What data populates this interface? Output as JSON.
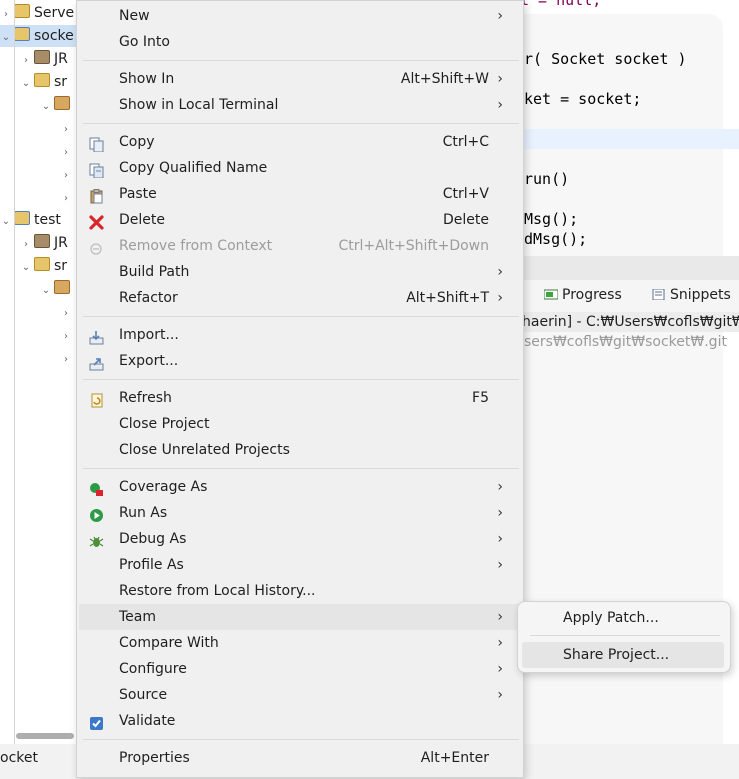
{
  "explorer": {
    "rows": [
      {
        "label": "Serve",
        "arrow": "›",
        "icon": "folder-icon"
      },
      {
        "label": "socke",
        "arrow": "⌄",
        "icon": "project-icon",
        "selected": true
      },
      {
        "label": "JR",
        "arrow": "›",
        "icon": "library-icon"
      },
      {
        "label": "sr",
        "arrow": "⌄",
        "icon": "source-folder-icon"
      },
      {
        "label": "",
        "arrow": "⌄",
        "icon": "package-icon"
      },
      {
        "label": "",
        "arrow": "›",
        "icon": ""
      },
      {
        "label": "",
        "arrow": "›",
        "icon": ""
      },
      {
        "label": "",
        "arrow": "›",
        "icon": ""
      },
      {
        "label": "",
        "arrow": "›",
        "icon": ""
      },
      {
        "label": "test",
        "arrow": "⌄",
        "icon": "project-icon"
      },
      {
        "label": "JR",
        "arrow": "›",
        "icon": "library-icon"
      },
      {
        "label": "sr",
        "arrow": "⌄",
        "icon": "source-folder-icon"
      },
      {
        "label": "",
        "arrow": "⌄",
        "icon": "package-icon"
      },
      {
        "label": "",
        "arrow": "›",
        "icon": ""
      },
      {
        "label": "",
        "arrow": "›",
        "icon": ""
      },
      {
        "label": "",
        "arrow": "›",
        "icon": ""
      }
    ]
  },
  "status": {
    "text": "ocket"
  },
  "editor": {
    "top_fragment": "t          = null;",
    "lines": [
      "r( Socket socket )",
      "ket = socket;",
      "",
      "run()",
      "Msg();",
      "dMsg();"
    ]
  },
  "views": {
    "tabs": [
      {
        "label": "Progress",
        "icon": "progress-icon"
      },
      {
        "label": "Snippets",
        "icon": "snippets-icon"
      }
    ],
    "header": "haerin] - C:₩Users₩cofls₩git₩ru",
    "sub": "sers₩cofls₩git₩socket₩.git"
  },
  "menu": {
    "items": [
      {
        "label": "New",
        "accel": "",
        "submenu": true
      },
      {
        "label": "Go Into",
        "accel": "",
        "submenu": false
      },
      {
        "label": "Show In",
        "accel": "Alt+Shift+W",
        "submenu": true
      },
      {
        "label": "Show in Local Terminal",
        "accel": "",
        "submenu": true
      },
      {
        "label": "Copy",
        "accel": "Ctrl+C",
        "submenu": false,
        "icon": "copy-icon"
      },
      {
        "label": "Copy Qualified Name",
        "accel": "",
        "submenu": false,
        "icon": "copy-qualified-icon"
      },
      {
        "label": "Paste",
        "accel": "Ctrl+V",
        "submenu": false,
        "icon": "paste-icon"
      },
      {
        "label": "Delete",
        "accel": "Delete",
        "submenu": false,
        "icon": "delete-icon"
      },
      {
        "label": "Remove from Context",
        "accel": "Ctrl+Alt+Shift+Down",
        "submenu": false,
        "icon": "remove-context-icon",
        "disabled": true
      },
      {
        "label": "Build Path",
        "accel": "",
        "submenu": true
      },
      {
        "label": "Refactor",
        "accel": "Alt+Shift+T",
        "submenu": true
      },
      {
        "label": "Import...",
        "accel": "",
        "submenu": false,
        "icon": "import-icon"
      },
      {
        "label": "Export...",
        "accel": "",
        "submenu": false,
        "icon": "export-icon"
      },
      {
        "label": "Refresh",
        "accel": "F5",
        "submenu": false,
        "icon": "refresh-icon"
      },
      {
        "label": "Close Project",
        "accel": "",
        "submenu": false
      },
      {
        "label": "Close Unrelated Projects",
        "accel": "",
        "submenu": false
      },
      {
        "label": "Coverage As",
        "accel": "",
        "submenu": true,
        "icon": "coverage-icon"
      },
      {
        "label": "Run As",
        "accel": "",
        "submenu": true,
        "icon": "run-icon"
      },
      {
        "label": "Debug As",
        "accel": "",
        "submenu": true,
        "icon": "debug-icon"
      },
      {
        "label": "Profile As",
        "accel": "",
        "submenu": true
      },
      {
        "label": "Restore from Local History...",
        "accel": "",
        "submenu": false
      },
      {
        "label": "Team",
        "accel": "",
        "submenu": true,
        "hover": true
      },
      {
        "label": "Compare With",
        "accel": "",
        "submenu": true
      },
      {
        "label": "Configure",
        "accel": "",
        "submenu": true
      },
      {
        "label": "Source",
        "accel": "",
        "submenu": true
      },
      {
        "label": "Validate",
        "accel": "",
        "submenu": false,
        "icon": "checkbox-checked-icon"
      },
      {
        "label": "Properties",
        "accel": "Alt+Enter",
        "submenu": false
      }
    ],
    "submenu_arrow": "›"
  },
  "team_submenu": {
    "items": [
      {
        "label": "Apply Patch..."
      },
      {
        "label": "Share Project...",
        "hover": true
      }
    ]
  },
  "colors": {
    "menu_bg": "#f0f0f0",
    "hover_bg": "#e5e5e5",
    "selection_bg": "#cde0f5",
    "keyword": "#7f0055",
    "variable": "#6a3e9e",
    "delete_red": "#d8242a",
    "run_green": "#2c9a46"
  }
}
